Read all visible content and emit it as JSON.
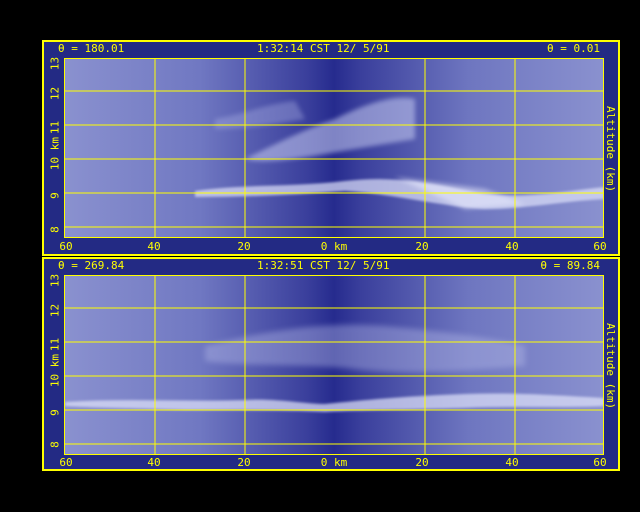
{
  "panels": [
    {
      "header_left": "θ = 180.01",
      "header_center": "1:32:14 CST 12/ 5/91",
      "header_right": "θ = 0.01",
      "y_ticks": [
        "13",
        "12",
        "11",
        "10 km",
        "9",
        "8"
      ],
      "x_ticks": [
        "60",
        "40",
        "20",
        "0 km",
        "20",
        "40",
        "60"
      ],
      "y_axis_label": "Altitude (km)"
    },
    {
      "header_left": "θ = 269.84",
      "header_center": "1:32:51 CST 12/ 5/91",
      "header_right": "θ = 89.84",
      "y_ticks": [
        "13",
        "12",
        "11",
        "10 km",
        "9",
        "8"
      ],
      "x_ticks": [
        "60",
        "40",
        "20",
        "0 km",
        "20",
        "40",
        "60"
      ],
      "y_axis_label": "Altitude (km)"
    }
  ],
  "colors": {
    "frame": "#ffff00",
    "background": "#232a84",
    "grid": "#ffff00"
  }
}
